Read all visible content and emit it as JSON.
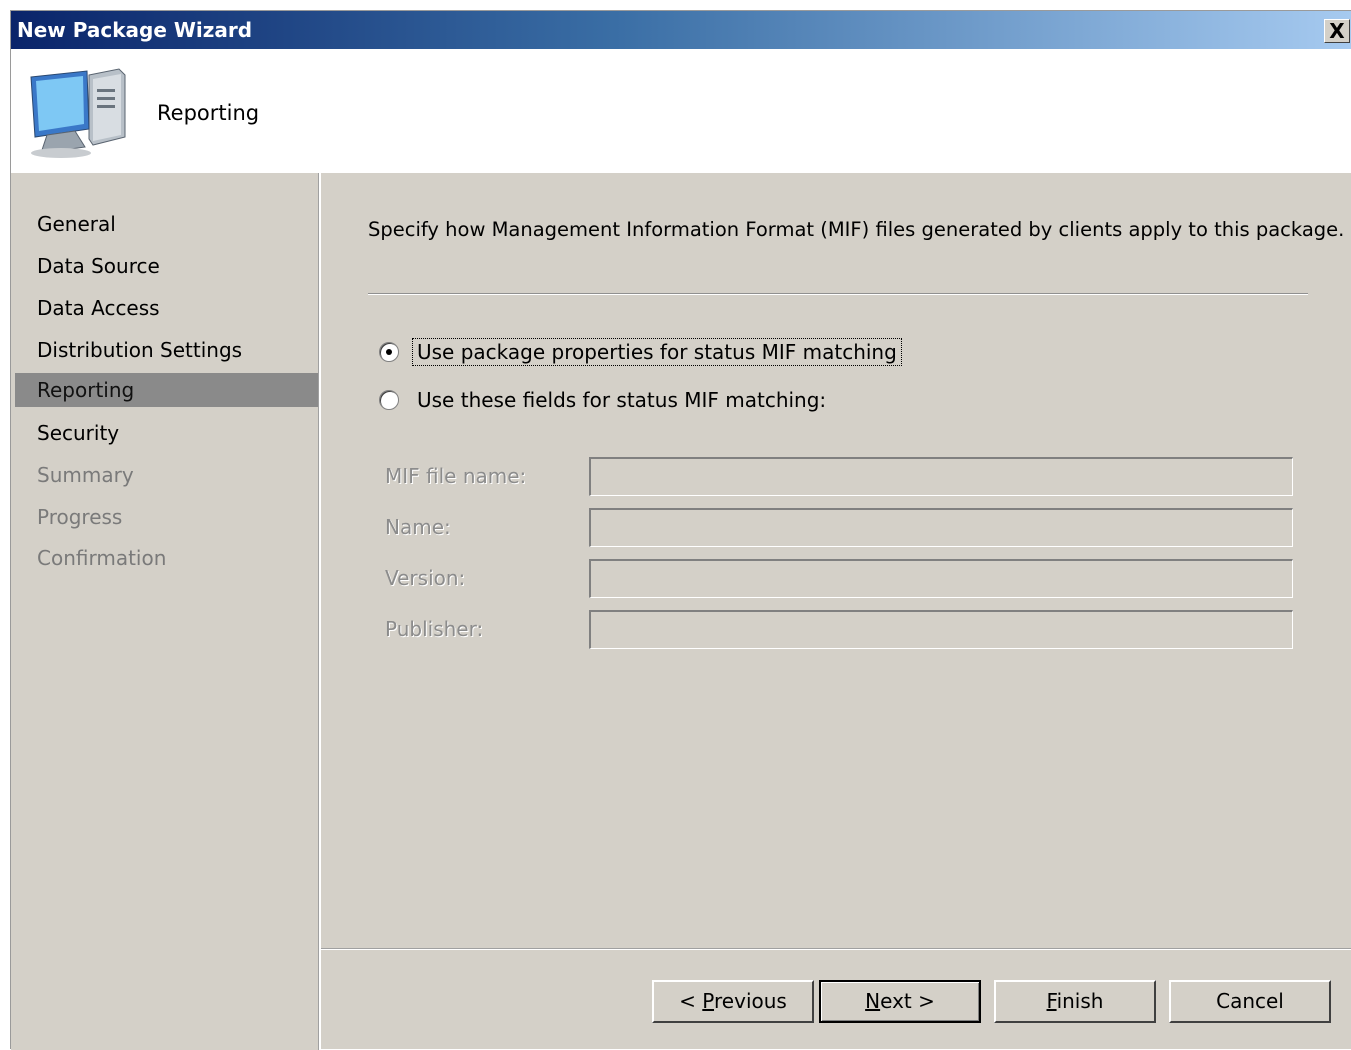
{
  "window": {
    "title": "New Package Wizard",
    "close_label": "X"
  },
  "header": {
    "title": "Reporting",
    "icon": "computer-package-icon"
  },
  "sidebar": {
    "items": [
      {
        "label": "General",
        "state": "normal"
      },
      {
        "label": "Data Source",
        "state": "normal"
      },
      {
        "label": "Data Access",
        "state": "normal"
      },
      {
        "label": "Distribution Settings",
        "state": "normal"
      },
      {
        "label": "Reporting",
        "state": "active"
      },
      {
        "label": "Security",
        "state": "normal"
      },
      {
        "label": "Summary",
        "state": "disabled"
      },
      {
        "label": "Progress",
        "state": "disabled"
      },
      {
        "label": "Confirmation",
        "state": "disabled"
      }
    ]
  },
  "main": {
    "intro": "Specify how Management Information Format (MIF) files generated by clients apply to this package.",
    "radio_options": [
      {
        "label": "Use package properties for status MIF matching",
        "checked": true
      },
      {
        "label": "Use these fields for status MIF matching:",
        "checked": false
      }
    ],
    "fields": [
      {
        "label": "MIF file name:",
        "value": ""
      },
      {
        "label": "Name:",
        "value": ""
      },
      {
        "label": "Version:",
        "value": ""
      },
      {
        "label": "Publisher:",
        "value": ""
      }
    ]
  },
  "buttons": {
    "previous": {
      "pre": "< ",
      "accel": "P",
      "rest": "revious"
    },
    "next": {
      "accel": "N",
      "rest": "ext >"
    },
    "finish": {
      "accel": "F",
      "rest": "inish"
    },
    "cancel": "Cancel"
  }
}
